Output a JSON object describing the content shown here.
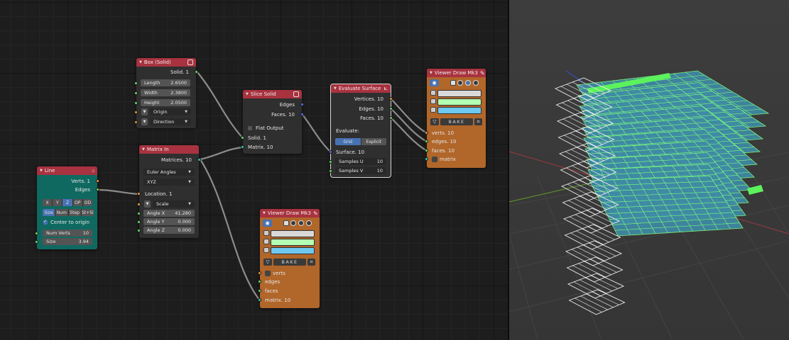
{
  "nodes": {
    "box": {
      "title": "Box (Solid)",
      "out_solid": "Solid. 1",
      "length_label": "Length",
      "length_value": "2.6500",
      "width_label": "Width",
      "width_value": "2.3800",
      "height_label": "Height",
      "height_value": "2.0500",
      "origin": "Origin",
      "direction": "Direction"
    },
    "line": {
      "title": "Line",
      "out_verts": "Verts. 1",
      "out_edges": "Edges",
      "axes": [
        "X",
        "Y",
        "Z",
        "OP",
        "OD"
      ],
      "modes": [
        "Size",
        "Num",
        "Step",
        "St+Si"
      ],
      "center_label": "Center to origin",
      "num_verts_label": "Num Verts",
      "num_verts_value": "10",
      "size_label": "Size",
      "size_value": "3.94"
    },
    "matrix_in": {
      "title": "Matrix In",
      "out_matrices": "Matrices. 10",
      "euler": "Euler Angles",
      "order": "XYZ",
      "location": "Location. 1",
      "scale": "Scale",
      "angle_x_label": "Angle X",
      "angle_x_value": "41.280",
      "angle_y_label": "Angle Y",
      "angle_y_value": "0.000",
      "angle_z_label": "Angle Z",
      "angle_z_value": "0.000"
    },
    "slice": {
      "title": "Slice Solid",
      "out_edges": "Edges",
      "out_faces": "Faces. 10",
      "flat_label": "Flat Output",
      "in_solid": "Solid. 1",
      "in_matrix": "Matrix. 10"
    },
    "evaluate": {
      "title": "Evaluate Surface",
      "out_vertices": "Vertices. 10",
      "out_edges": "Edges. 10",
      "out_faces": "Faces. 10",
      "evaluate_label": "Evaluate:",
      "modes": [
        "Grid",
        "Explicit"
      ],
      "in_surface": "Surface. 10",
      "samples_u_label": "Samples U",
      "samples_u_value": "10",
      "samples_v_label": "Samples V",
      "samples_v_value": "10"
    },
    "viewer_top": {
      "title": "Viewer Draw Mk3",
      "bake": "BAKE",
      "in_verts": "verts. 10",
      "in_edges": "edges. 10",
      "in_faces": "faces. 10",
      "in_matrix": "matrix"
    },
    "viewer_bottom": {
      "title": "Viewer Draw Mk3",
      "bake": "BAKE",
      "in_verts": "verts",
      "in_edges": "edges",
      "in_faces": "faces",
      "in_matrix": "matrix. 10"
    }
  },
  "colors": {
    "header_red": "#a8323f",
    "line_node": "#0f6960",
    "viewer_node": "#b1662a",
    "socket_vertices": "#e6973c",
    "socket_string": "#6bd66b",
    "socket_matrix": "#2fc6b0",
    "socket_surface": "#5b6ff0",
    "vertex_color": "#d9d9d9",
    "edge_color": "#b3ffb3",
    "face_color": "#6ec8f0",
    "mesh_face": "#3f8aa5",
    "mesh_edge": "#7dff7d"
  },
  "icons": [
    "collapse-arrow-icon",
    "solid-icon",
    "pencil-icon",
    "surface-icon",
    "eye-icon",
    "bake-icon",
    "menu-grip-icon"
  ]
}
